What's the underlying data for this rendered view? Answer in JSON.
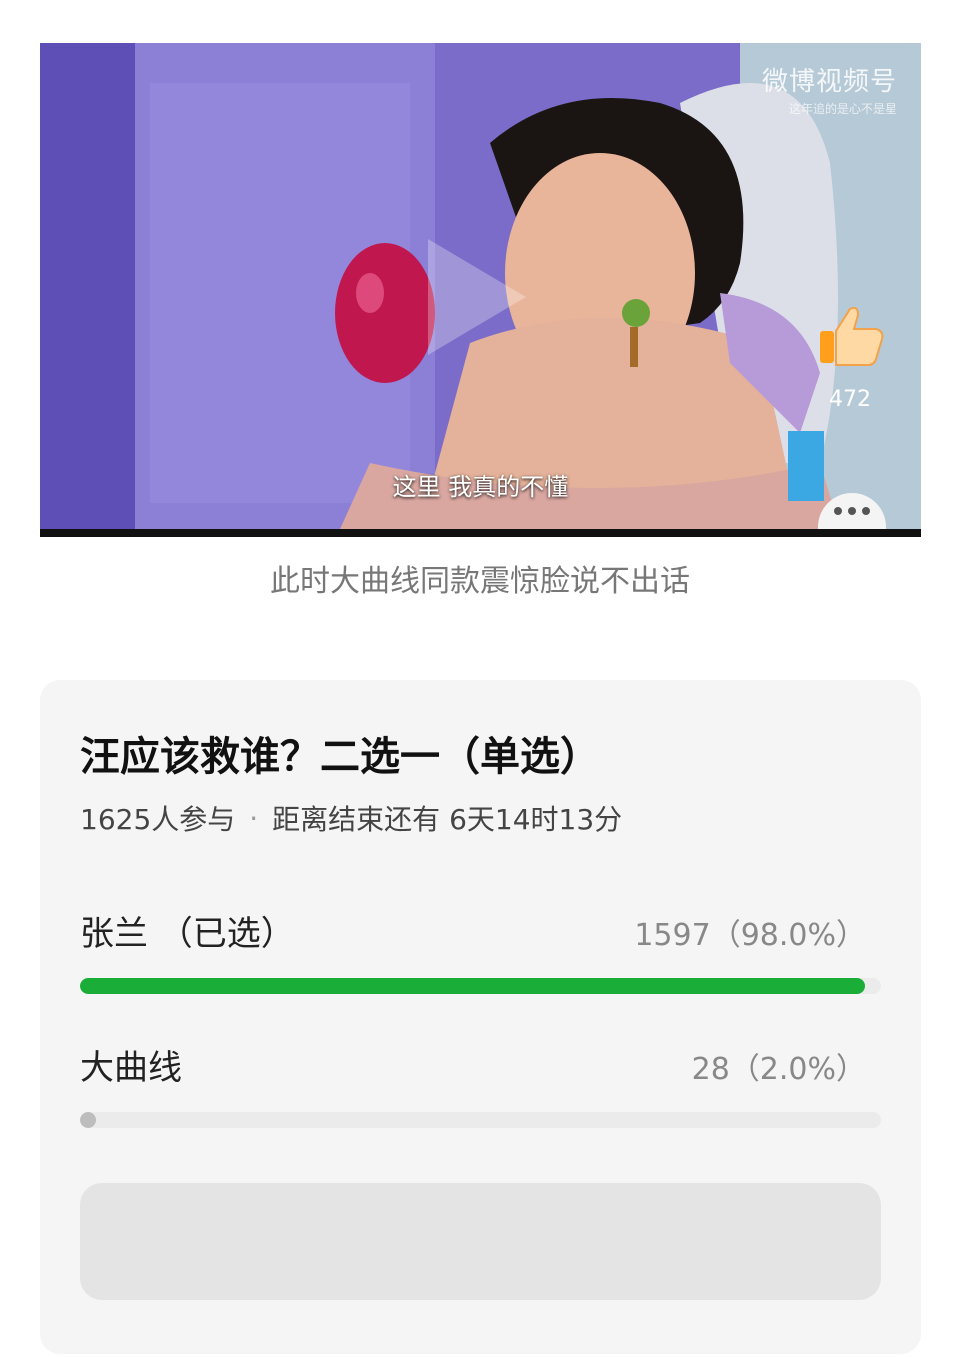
{
  "video": {
    "watermark_title": "微博视频号",
    "watermark_sub": "这年追的是心不是星",
    "subtitle": "这里 我真的不懂",
    "like_count": "472"
  },
  "caption": "此时大曲线同款震惊脸说不出话",
  "poll": {
    "title": "汪应该救谁？二选一（单选）",
    "participants": "1625人参与",
    "separator": "·",
    "remaining": "距离结束还有 6天14时13分",
    "options": [
      {
        "label": "张兰 （已选）",
        "count": "1597（98.0%）",
        "fraction": 0.98,
        "color": "#1aad37"
      },
      {
        "label": "大曲线",
        "count": "28（2.0%）",
        "fraction": 0.02,
        "color": "#bdbdbd"
      }
    ]
  }
}
